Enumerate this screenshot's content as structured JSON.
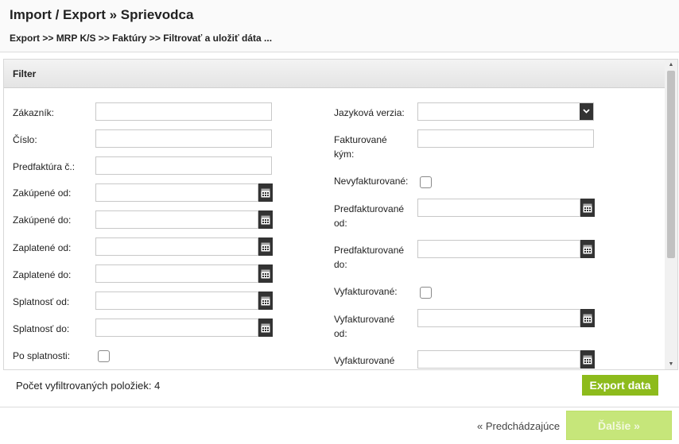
{
  "header": {
    "title": "Import / Export » Sprievodca",
    "breadcrumb": "Export >> MRP K/S >> Faktúry >> Filtrovať a uložiť dáta ..."
  },
  "filter": {
    "title": "Filter",
    "left": {
      "customer_label": "Zákazník:",
      "customer_value": "",
      "number_label": "Číslo:",
      "number_value": "",
      "proforma_label": "Predfaktúra č.:",
      "proforma_value": "",
      "purchased_from_label": "Zakúpené od:",
      "purchased_to_label": "Zakúpené do:",
      "paid_from_label": "Zaplatené od:",
      "paid_to_label": "Zaplatené do:",
      "due_from_label": "Splatnosť od:",
      "due_to_label": "Splatnosť do:",
      "overdue_label": "Po splatnosti:"
    },
    "right": {
      "language_label": "Jazyková verzia:",
      "language_value": "",
      "invoiced_by_label_1": "Fakturované",
      "invoiced_by_label_2": "kým:",
      "invoiced_by_value": "",
      "not_invoiced_label": "Nevyfakturované:",
      "preinvoiced_from_label_1": "Predfakturované",
      "preinvoiced_from_label_2": "od:",
      "preinvoiced_to_label_1": "Predfakturované",
      "preinvoiced_to_label_2": "do:",
      "invoiced_label": "Vyfakturované:",
      "invoiced_from_label_1": "Vyfakturované",
      "invoiced_from_label_2": "od:",
      "invoiced_to_label_1": "Vyfakturované"
    }
  },
  "footer": {
    "count_label": "Počet vyfiltrovaných položiek: 4",
    "export_button": "Export data"
  },
  "nav": {
    "prev_label": "« Predchádzajúce",
    "next_label": "Ďalšie »"
  },
  "colors": {
    "accent": "#8dbb1c",
    "next_disabled": "#c6e67a"
  }
}
